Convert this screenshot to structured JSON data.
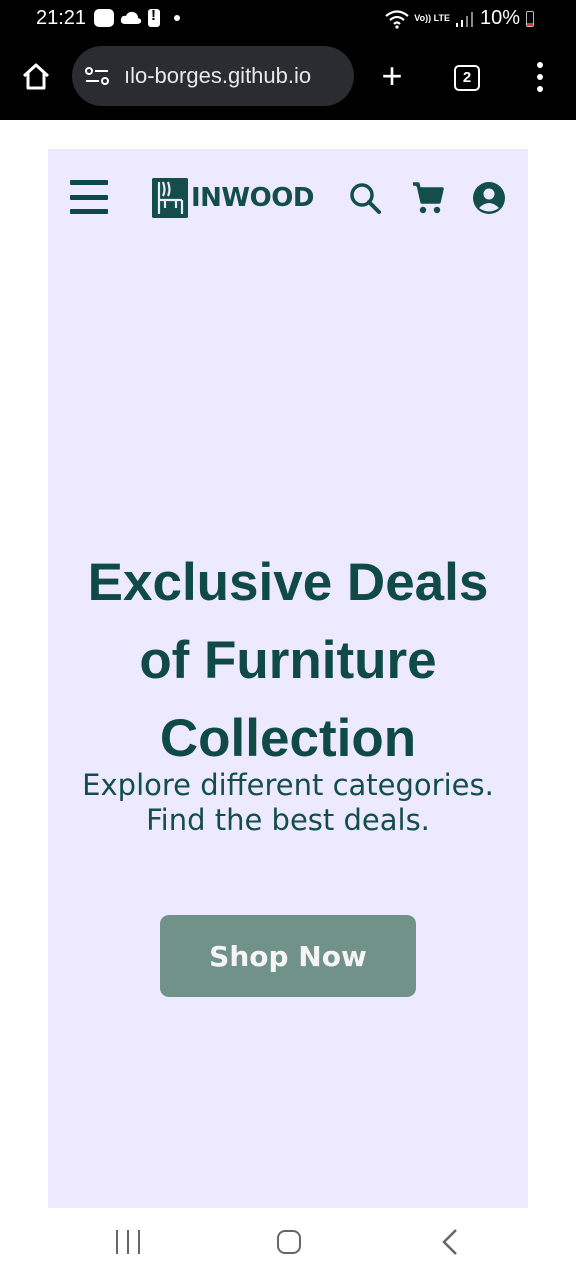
{
  "status_bar": {
    "time": "21:21",
    "network_label": "Vo)) LTE",
    "battery": "10%",
    "icons": [
      "message-icon",
      "cloud-icon",
      "alert-icon",
      "notification-dot-icon",
      "wifi-icon",
      "signal-icon",
      "battery-icon"
    ]
  },
  "browser": {
    "url": "ılo-borges.github.io",
    "new_tab": "+",
    "tab_count": "2"
  },
  "site": {
    "brand": "INWOOD",
    "colors": {
      "brand": "#134e4a",
      "hero_bg": "#ede9fe",
      "button_bg": "#719288"
    }
  },
  "hero": {
    "title_line1": "Exclusive Deals",
    "title_line2": "of Furniture",
    "title_line3": "Collection",
    "subtitle_line1": "Explore different categories.",
    "subtitle_line2": "Find the best deals.",
    "cta": "Shop Now"
  }
}
